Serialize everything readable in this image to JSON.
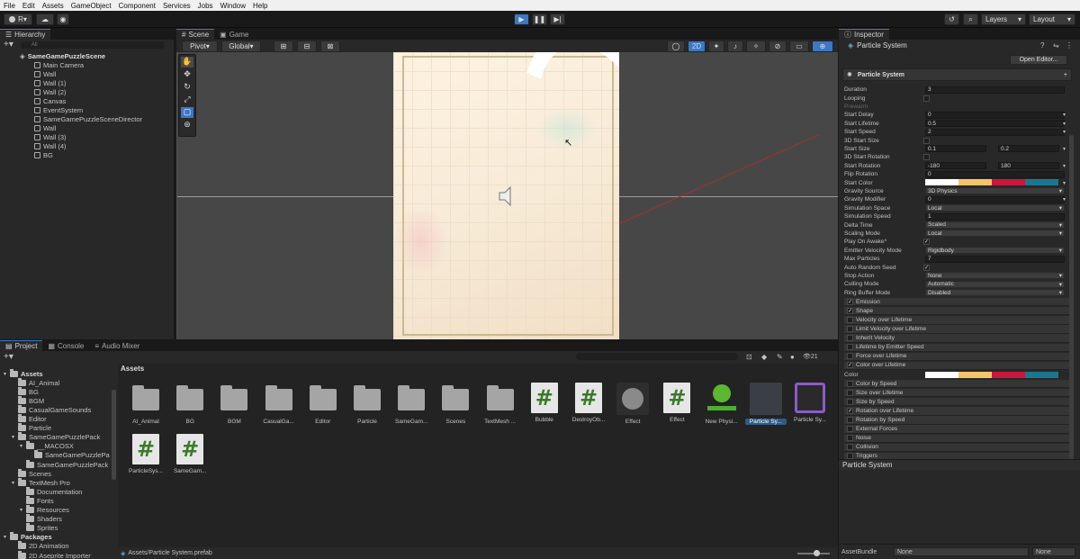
{
  "menubar": [
    "File",
    "Edit",
    "Assets",
    "GameObject",
    "Component",
    "Services",
    "Jobs",
    "Window",
    "Help"
  ],
  "toolbar": {
    "account": "R",
    "layers": "Layers",
    "layout": "Layout"
  },
  "hierarchy": {
    "tab": "Hierarchy",
    "search_placeholder": "All",
    "scene": "SameGamePuzzleScene",
    "items": [
      "Main Camera",
      "Wall",
      "Wall (1)",
      "Wall (2)",
      "Canvas",
      "EventSystem",
      "SameGamePuzzleSceneDirector",
      "Wall",
      "Wall (3)",
      "Wall (4)",
      "BG"
    ]
  },
  "scene": {
    "tabs": [
      "Scene",
      "Game"
    ],
    "pivot": "Pivot",
    "global": "Global",
    "mode2d": "2D"
  },
  "inspector": {
    "tab": "Inspector",
    "title": "Particle System",
    "open_editor": "Open Editor...",
    "component": "Particle System",
    "props": [
      {
        "label": "Duration",
        "v1": "3"
      },
      {
        "label": "Looping",
        "check": ""
      },
      {
        "label": "Prewarm",
        "disabled": true
      },
      {
        "label": "Start Delay",
        "v1": "0",
        "drop": true
      },
      {
        "label": "Start Lifetime",
        "v1": "0.5",
        "drop": true
      },
      {
        "label": "Start Speed",
        "v1": "2",
        "drop": true
      },
      {
        "label": "3D Start Size",
        "check": ""
      },
      {
        "label": "Start Size",
        "v1": "0.1",
        "v2": "0.2",
        "drop": true
      },
      {
        "label": "3D Start Rotation",
        "check": ""
      },
      {
        "label": "Start Rotation",
        "v1": "-180",
        "v2": "180",
        "drop": true
      },
      {
        "label": "Flip Rotation",
        "v1": "0"
      },
      {
        "label": "Start Color",
        "color": true
      },
      {
        "label": "Gravity Source",
        "v1": "3D Physics",
        "select": true
      },
      {
        "label": "Gravity Modifier",
        "v1": "0",
        "drop": true
      },
      {
        "label": "Simulation Space",
        "v1": "Local",
        "select": true
      },
      {
        "label": "Simulation Speed",
        "v1": "1"
      },
      {
        "label": "Delta Time",
        "v1": "Scaled",
        "select": true
      },
      {
        "label": "Scaling Mode",
        "v1": "Local",
        "select": true
      },
      {
        "label": "Play On Awake*",
        "check": "✓"
      },
      {
        "label": "Emitter Velocity Mode",
        "v1": "Rigidbody",
        "select": true
      },
      {
        "label": "Max Particles",
        "v1": "7"
      },
      {
        "label": "Auto Random Seed",
        "check": "✓"
      },
      {
        "label": "Stop Action",
        "v1": "None",
        "select": true
      },
      {
        "label": "Culling Mode",
        "v1": "Automatic",
        "select": true
      },
      {
        "label": "Ring Buffer Mode",
        "v1": "Disabled",
        "select": true
      }
    ],
    "modules": [
      {
        "label": "Emission",
        "check": "✓"
      },
      {
        "label": "Shape",
        "check": "✓"
      },
      {
        "label": "Velocity over Lifetime",
        "check": ""
      },
      {
        "label": "Limit Velocity over Lifetime",
        "check": ""
      },
      {
        "label": "Inherit Velocity",
        "check": ""
      },
      {
        "label": "Lifetime by Emitter Speed",
        "check": ""
      },
      {
        "label": "Force over Lifetime",
        "check": ""
      },
      {
        "label": "Color over Lifetime",
        "check": "✓"
      }
    ],
    "color_row": "Color",
    "modules2": [
      {
        "label": "Color by Speed",
        "check": ""
      },
      {
        "label": "Size over Lifetime",
        "check": ""
      },
      {
        "label": "Size by Speed",
        "check": ""
      },
      {
        "label": "Rotation over Lifetime",
        "check": "✓"
      },
      {
        "label": "Rotation by Speed",
        "check": ""
      },
      {
        "label": "External Forces",
        "check": ""
      },
      {
        "label": "Noise",
        "check": ""
      },
      {
        "label": "Collision",
        "check": ""
      },
      {
        "label": "Triggers",
        "check": ""
      }
    ],
    "footer_title": "Particle System",
    "assetbundle_label": "AssetBundle",
    "assetbundle_value": "None",
    "assetbundle_variant": "None"
  },
  "project": {
    "tabs": [
      "Project",
      "Console",
      "Audio Mixer"
    ],
    "tree": [
      {
        "label": "Assets",
        "indent": 0,
        "bold": true
      },
      {
        "label": "AI_Animal",
        "indent": 1
      },
      {
        "label": "BG",
        "indent": 1
      },
      {
        "label": "BGM",
        "indent": 1
      },
      {
        "label": "CasualGameSounds",
        "indent": 1
      },
      {
        "label": "Editor",
        "indent": 1
      },
      {
        "label": "Particle",
        "indent": 1
      },
      {
        "label": "SameGamePuzzlePack",
        "indent": 1
      },
      {
        "label": "__MACOSX",
        "indent": 2
      },
      {
        "label": "SameGamePuzzlePa",
        "indent": 3
      },
      {
        "label": "SameGamePuzzlePack",
        "indent": 2
      },
      {
        "label": "Scenes",
        "indent": 1
      },
      {
        "label": "TextMesh Pro",
        "indent": 1
      },
      {
        "label": "Documentation",
        "indent": 2
      },
      {
        "label": "Fonts",
        "indent": 2
      },
      {
        "label": "Resources",
        "indent": 2
      },
      {
        "label": "Shaders",
        "indent": 2
      },
      {
        "label": "Sprites",
        "indent": 2
      },
      {
        "label": "Packages",
        "indent": 0,
        "bold": true
      },
      {
        "label": "2D Animation",
        "indent": 1
      },
      {
        "label": "2D Aseprite Importer",
        "indent": 1
      }
    ],
    "breadcrumb": "Assets",
    "count": "21",
    "assets": [
      {
        "label": "AI_Animal",
        "kind": "folder"
      },
      {
        "label": "BG",
        "kind": "folder"
      },
      {
        "label": "BGM",
        "kind": "folder"
      },
      {
        "label": "CasualGa...",
        "kind": "folder"
      },
      {
        "label": "Editor",
        "kind": "folder"
      },
      {
        "label": "Particle",
        "kind": "folder"
      },
      {
        "label": "SameGam...",
        "kind": "folder"
      },
      {
        "label": "Scenes",
        "kind": "folder"
      },
      {
        "label": "TextMesh ...",
        "kind": "folder"
      },
      {
        "label": "Bubble",
        "kind": "script"
      },
      {
        "label": "DestroyOb...",
        "kind": "script"
      },
      {
        "label": "Effect",
        "kind": "prefab"
      },
      {
        "label": "Effect",
        "kind": "script"
      },
      {
        "label": "New Physi...",
        "kind": "physics"
      },
      {
        "label": "Particle Sy...",
        "kind": "particle",
        "selected": true
      },
      {
        "label": "Particle Sy...",
        "kind": "psicon"
      },
      {
        "label": "ParticleSys...",
        "kind": "script"
      },
      {
        "label": "SameGam...",
        "kind": "script"
      }
    ],
    "status_path": "Assets/Particle System.prefab"
  },
  "colors": {
    "accent": "#2c5d87",
    "play": "#3a78c8",
    "bg": "#282828"
  }
}
